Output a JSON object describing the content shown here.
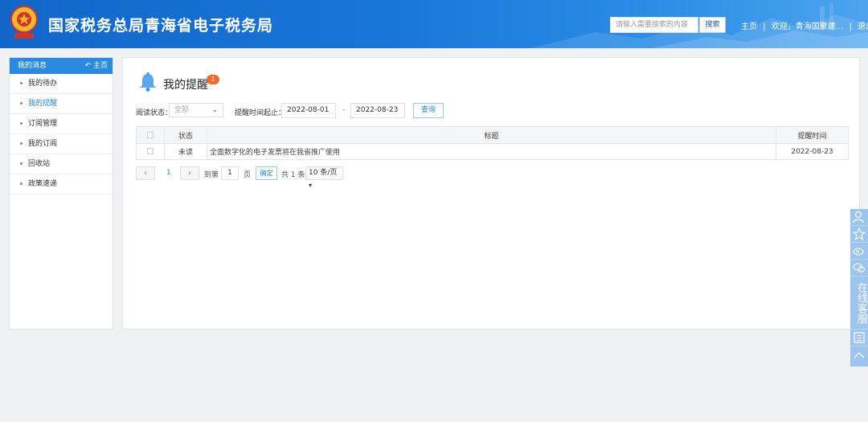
{
  "header": {
    "title": "国家税务总局青海省电子税务局",
    "search_placeholder": "请输入需要搜索的内容",
    "search_button": "搜索",
    "home_link": "主页",
    "welcome": "欢迎，青海国聚建...",
    "logout": "退出",
    "separator": "|"
  },
  "sidebar": {
    "title": "我的消息",
    "home_label": "主页",
    "items": [
      {
        "label": "我的待办"
      },
      {
        "label": "我的提醒"
      },
      {
        "label": "订阅管理"
      },
      {
        "label": "我的订阅"
      },
      {
        "label": "回收站"
      },
      {
        "label": "政策速递"
      }
    ],
    "active_index": 1
  },
  "main": {
    "title": "我的提醒",
    "badge": "1",
    "filter": {
      "read_status_label": "阅读状态：",
      "read_status_value": "全部",
      "time_label": "提醒时间起止：",
      "start_date": "2022-08-01",
      "separator": "-",
      "end_date": "2022-08-23",
      "query_button": "查询"
    },
    "table": {
      "headers": {
        "status": "状态",
        "title": "标题",
        "time": "提醒时间"
      },
      "rows": [
        {
          "status": "未读",
          "title": "全面数字化的电子发票将在我省推广使用",
          "time": "2022-08-23"
        }
      ]
    },
    "pager": {
      "prev": "‹",
      "current_page": "1",
      "next": "›",
      "goto_label": "到第",
      "goto_value": "1",
      "page_unit": "页",
      "confirm": "确定",
      "total": "共 1 条",
      "page_size": "10 条/页"
    }
  },
  "floatbar": {
    "service_text": "在线客服",
    "icons": [
      "user-icon",
      "star-icon",
      "weibo-icon",
      "wechat-icon",
      "qrcode-icon",
      "back-to-top-icon"
    ]
  },
  "colors": {
    "header_blue": "#1167c9",
    "accent": "#2a8ae0",
    "badge": "#f06a2c"
  }
}
